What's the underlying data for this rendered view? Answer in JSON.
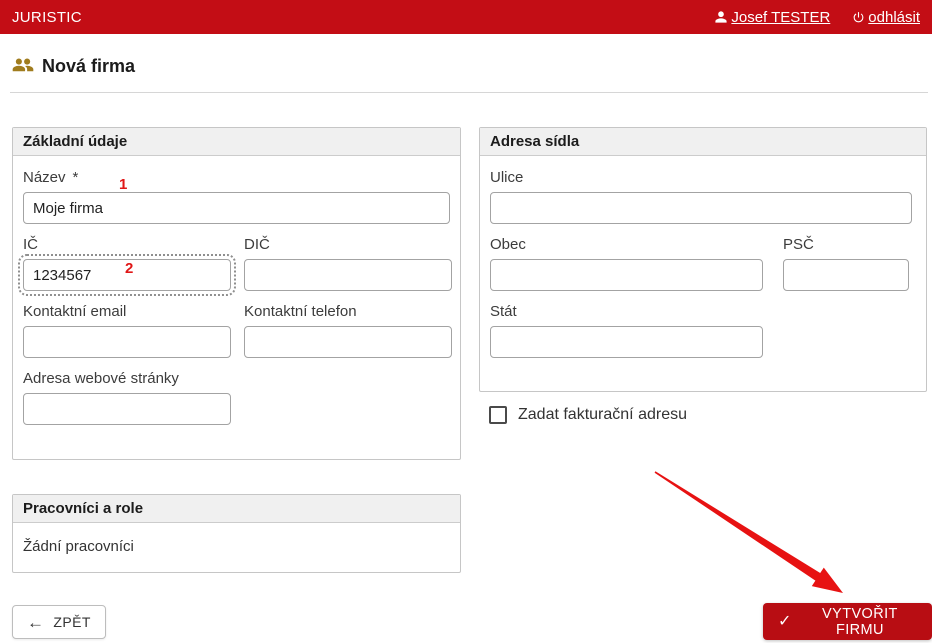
{
  "header": {
    "brand": "JURISTIC",
    "user_label": "Josef TESTER",
    "logout_label": "odhlásit"
  },
  "page": {
    "title": "Nová firma"
  },
  "basic_panel": {
    "title": "Základní údaje",
    "fields": {
      "nazev": {
        "label": "Název",
        "required_mark": "*",
        "value": "Moje firma"
      },
      "ic": {
        "label": "IČ",
        "value": "1234567"
      },
      "dic": {
        "label": "DIČ",
        "value": ""
      },
      "email": {
        "label": "Kontaktní email",
        "value": ""
      },
      "telefon": {
        "label": "Kontaktní telefon",
        "value": ""
      },
      "web": {
        "label": "Adresa webové stránky",
        "value": ""
      }
    }
  },
  "address_panel": {
    "title": "Adresa sídla",
    "fields": {
      "ulice": {
        "label": "Ulice",
        "value": ""
      },
      "obec": {
        "label": "Obec",
        "value": ""
      },
      "psc": {
        "label": "PSČ",
        "value": ""
      },
      "stat": {
        "label": "Stát",
        "value": ""
      }
    }
  },
  "billing_checkbox": {
    "label": "Zadat fakturační adresu",
    "checked": false
  },
  "workers_panel": {
    "title": "Pracovníci a role",
    "empty_text": "Žádní pracovníci"
  },
  "actions": {
    "back_label": "ZPĚT",
    "back_icon": "←",
    "create_label": "VYTVOŘIT FIRMU",
    "create_icon": "✓"
  },
  "annotations": {
    "step1": "1",
    "step2": "2"
  },
  "colors": {
    "brand_red": "#c30d15",
    "button_red": "#b80d13",
    "annotation_red": "#e01717",
    "title_icon_gold": "#a07c1e"
  }
}
